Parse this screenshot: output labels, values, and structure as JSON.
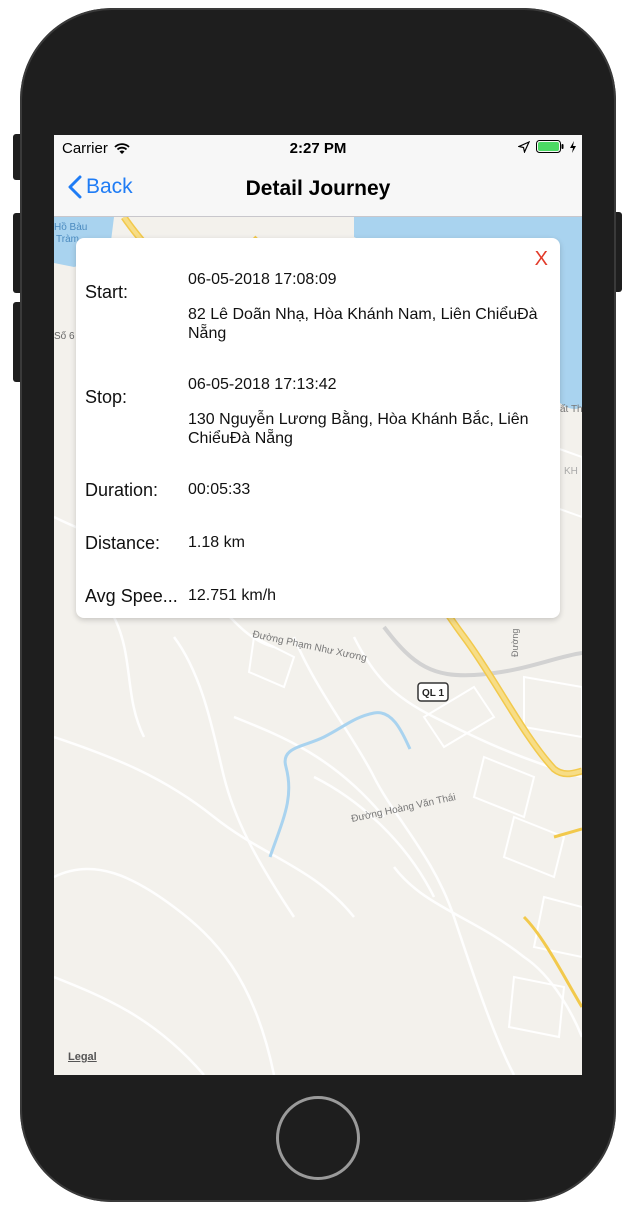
{
  "status_bar": {
    "carrier": "Carrier",
    "time": "2:27 PM",
    "icons": [
      "wifi-icon",
      "location-arrow-icon",
      "battery-icon",
      "charging-bolt-icon"
    ]
  },
  "nav": {
    "back_label": "Back",
    "title": "Detail Journey",
    "accent_color": "#1f7cf5"
  },
  "journey": {
    "close_label": "X",
    "close_color": "#e23b2a",
    "start": {
      "label": "Start:",
      "time": "06-05-2018 17:08:09",
      "address": "82 Lê Doãn Nhạ, Hòa Khánh Nam, Liên ChiểuĐà Nẵng"
    },
    "stop": {
      "label": "Stop:",
      "time": "06-05-2018 17:13:42",
      "address": "130 Nguyễn Lương Bằng, Hòa Khánh Bắc, Liên ChiểuĐà Nẵng"
    },
    "duration": {
      "label": "Duration:",
      "value": "00:05:33"
    },
    "distance": {
      "label": "Distance:",
      "value": "1.18 km"
    },
    "avg_speed": {
      "label": "Avg Spee...",
      "value": "12.751 km/h"
    }
  },
  "map": {
    "labels": {
      "lake": "Hồ Bàu",
      "lake2": "Tràm",
      "so6": "Số 6",
      "pham_nhu_xuong": "Đường Phạm Như Xương",
      "ql1": "QL 1",
      "hoang_van_thai": "Đường Hoàng Văn Thái",
      "duong_right": "Đường",
      "right_t": "ất Th",
      "right_kh": "KH"
    },
    "legal": "Legal"
  }
}
